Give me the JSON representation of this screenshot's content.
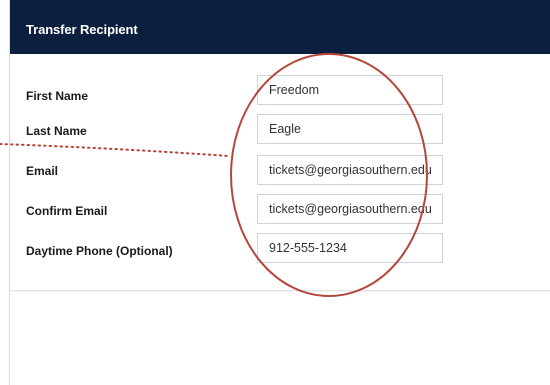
{
  "panel": {
    "title": "Transfer Recipient"
  },
  "fields": [
    {
      "label": "First Name",
      "value": "Freedom"
    },
    {
      "label": "Last Name",
      "value": "Eagle"
    },
    {
      "label": "Email",
      "value": "tickets@georgiasouthern.edu"
    },
    {
      "label": "Confirm Email",
      "value": "tickets@georgiasouthern.edu"
    },
    {
      "label": "Daytime Phone (Optional)",
      "value": "912-555-1234"
    }
  ],
  "colors": {
    "header_bg": "#0c1f3f",
    "annotation": "#b5463a"
  }
}
